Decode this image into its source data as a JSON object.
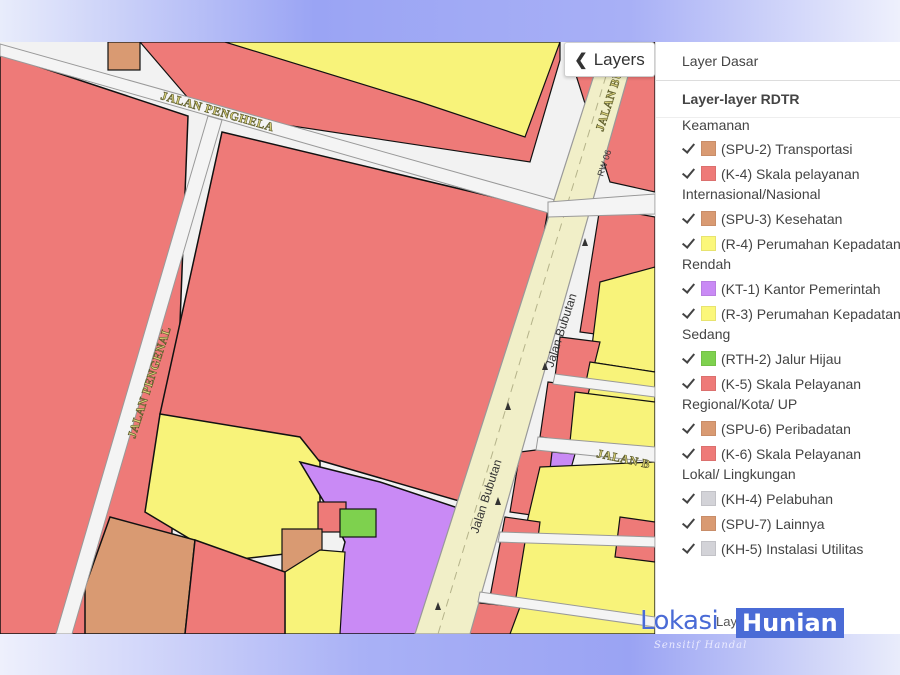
{
  "map": {
    "layers_button": {
      "chevron": "chevron-left-icon",
      "label": "Layers"
    },
    "roads": {
      "r1": "JALAN PENGHELA",
      "r2": "JALAN PENGENAL",
      "r3": "Jalan Bubutan",
      "r4": "Jalan Bubutan",
      "r5": "JALAN BUBUT",
      "r6": "JALAN B",
      "r7": "RW 06"
    }
  },
  "panel": {
    "base_layer_label": "Layer Dasar",
    "rdtr_title": "Layer-layer RDTR",
    "cut_item_text": "Keamanan",
    "items": [
      {
        "label": "(SPU-2) Transportasi",
        "color": "#d99a72",
        "checked": true
      },
      {
        "label": "(K-4) Skala pelayanan Internasional/Nasional",
        "color": "#ee7a78",
        "checked": true
      },
      {
        "label": "(SPU-3) Kesehatan",
        "color": "#d99a72",
        "checked": true
      },
      {
        "label": "(R-4) Perumahan Kepadatan Rendah",
        "color": "#fbf77a",
        "checked": true
      },
      {
        "label": "(KT-1) Kantor Pemerintah",
        "color": "#c98af5",
        "checked": true
      },
      {
        "label": "(R-3) Perumahan Kepadatan Sedang",
        "color": "#fbf77a",
        "checked": true
      },
      {
        "label": "(RTH-2) Jalur Hijau",
        "color": "#7ed14e",
        "checked": true
      },
      {
        "label": "(K-5) Skala Pelayanan Regional/Kota/ UP",
        "color": "#ee7a78",
        "checked": true
      },
      {
        "label": "(SPU-6) Peribadatan",
        "color": "#d99a72",
        "checked": true
      },
      {
        "label": "(K-6) Skala Pelayanan Lokal/ Lingkungan",
        "color": "#ee7a78",
        "checked": true
      },
      {
        "label": "(KH-4) Pelabuhan",
        "color": "#d3d3d8",
        "checked": true
      },
      {
        "label": "(SPU-7) Lainnya",
        "color": "#d99a72",
        "checked": true
      },
      {
        "label": "(KH-5) Instalasi Utilitas",
        "color": "#d3d3d8",
        "checked": true
      }
    ],
    "footer_text": "Layer layer"
  },
  "watermark": {
    "part1": "Lokasi",
    "part2": "Hunian",
    "tagline": "Sensitif Handal"
  },
  "colors": {
    "red_zone": "#ee7a78",
    "yellow_zone": "#f8f37a",
    "purple_zone": "#c98af5",
    "brown_zone": "#d99a72",
    "green_zone": "#7ed14e",
    "road": "#f2f2f2",
    "road_main": "#f1efc8"
  }
}
